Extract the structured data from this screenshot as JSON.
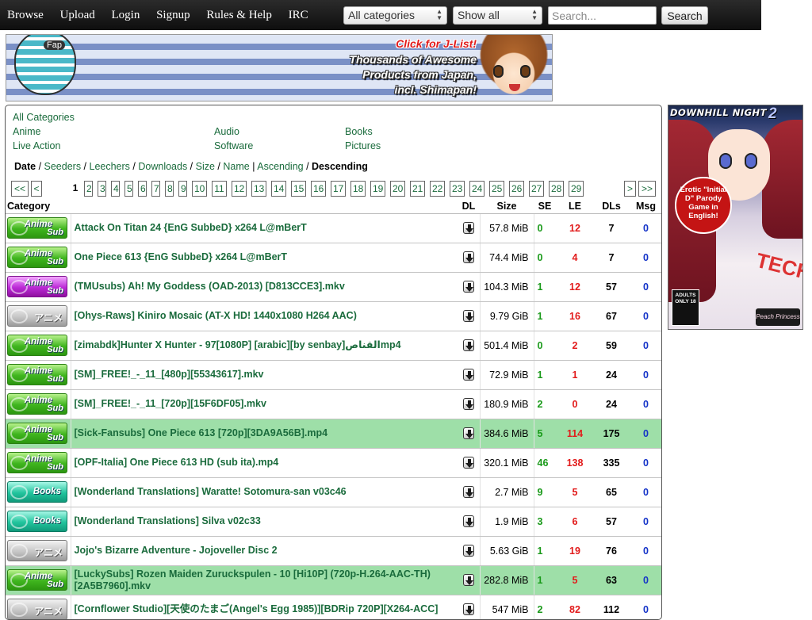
{
  "nav": {
    "items": [
      {
        "label": "Browse"
      },
      {
        "label": "Upload"
      },
      {
        "label": "Login"
      },
      {
        "label": "Signup"
      },
      {
        "label": "Rules & Help"
      },
      {
        "label": "IRC"
      }
    ]
  },
  "search": {
    "category_value": "All categories",
    "filter_value": "Show all",
    "placeholder": "Search...",
    "button_label": "Search"
  },
  "banner_top": {
    "headline": "Click for J-List!",
    "line1": "Thousands of Awesome",
    "line2": "Products from Japan,",
    "line3": "incl. Shimapan!",
    "hat_text": "Fap"
  },
  "categories": {
    "all": "All Categories",
    "anime": "Anime",
    "audio": "Audio",
    "books": "Books",
    "live_action": "Live Action",
    "software": "Software",
    "pictures": "Pictures"
  },
  "sort": {
    "date": "Date",
    "seeders": "Seeders",
    "leechers": "Leechers",
    "downloads": "Downloads",
    "size": "Size",
    "name": "Name",
    "ascending": "Ascending",
    "descending": "Descending"
  },
  "pager": {
    "first": "<<",
    "prev": "<",
    "next": ">",
    "last": ">>",
    "current": "1",
    "pages": [
      "2",
      "3",
      "4",
      "5",
      "6",
      "7",
      "8",
      "9",
      "10",
      "11",
      "12",
      "13",
      "14",
      "15",
      "16",
      "17",
      "18",
      "19",
      "20",
      "21",
      "22",
      "23",
      "24",
      "25",
      "26",
      "27",
      "28",
      "29"
    ]
  },
  "table": {
    "headers": {
      "category": "Category",
      "dl": "DL",
      "size": "Size",
      "se": "SE",
      "le": "LE",
      "dls": "DLs",
      "msg": "Msg"
    },
    "rows": [
      {
        "badge": "anime",
        "badge_l1": "Anime",
        "badge_l2": "Sub",
        "name": "Attack On Titan 24 {EnG SubbeD} x264 L@mBerT",
        "size": "57.8 MiB",
        "se": "0",
        "le": "12",
        "dls": "7",
        "msg": "0",
        "highlight": false
      },
      {
        "badge": "anime",
        "badge_l1": "Anime",
        "badge_l2": "Sub",
        "name": "One Piece 613 {EnG SubbeD} x264 L@mBerT",
        "size": "74.4 MiB",
        "se": "0",
        "le": "4",
        "dls": "7",
        "msg": "0",
        "highlight": false
      },
      {
        "badge": "animesub-p",
        "badge_l1": "Anime",
        "badge_l2": "Sub",
        "name": "(TMUsubs) Ah! My Goddess (OAD-2013) [D813CCE3].mkv",
        "size": "104.3 MiB",
        "se": "1",
        "le": "12",
        "dls": "57",
        "msg": "0",
        "highlight": false
      },
      {
        "badge": "raw",
        "badge_l1": "アニメ",
        "badge_l2": "",
        "name": "[Ohys-Raws] Kiniro Mosaic (AT-X HD! 1440x1080 H264 AAC)",
        "size": "9.79 GiB",
        "se": "1",
        "le": "16",
        "dls": "67",
        "msg": "0",
        "highlight": false
      },
      {
        "badge": "anime",
        "badge_l1": "Anime",
        "badge_l2": "Sub",
        "name": "[zimabdk]Hunter X Hunter - 97[1080P] [arabic][by senbay]القناصmp4",
        "size": "501.4 MiB",
        "se": "0",
        "le": "2",
        "dls": "59",
        "msg": "0",
        "highlight": false
      },
      {
        "badge": "anime",
        "badge_l1": "Anime",
        "badge_l2": "Sub",
        "name": "[SM]_FREE!_-_11_[480p][55343617].mkv",
        "size": "72.9 MiB",
        "se": "1",
        "le": "1",
        "dls": "24",
        "msg": "0",
        "highlight": false
      },
      {
        "badge": "anime",
        "badge_l1": "Anime",
        "badge_l2": "Sub",
        "name": "[SM]_FREE!_-_11_[720p][15F6DF05].mkv",
        "size": "180.9 MiB",
        "se": "2",
        "le": "0",
        "dls": "24",
        "msg": "0",
        "highlight": false
      },
      {
        "badge": "anime",
        "badge_l1": "Anime",
        "badge_l2": "Sub",
        "name": "[Sick-Fansubs] One Piece 613 [720p][3DA9A56B].mp4",
        "size": "384.6 MiB",
        "se": "5",
        "le": "114",
        "dls": "175",
        "msg": "0",
        "highlight": true
      },
      {
        "badge": "anime",
        "badge_l1": "Anime",
        "badge_l2": "Sub",
        "name": "[OPF-Italia] One Piece 613 HD (sub ita).mp4",
        "size": "320.1 MiB",
        "se": "46",
        "le": "138",
        "dls": "335",
        "msg": "0",
        "highlight": false
      },
      {
        "badge": "books",
        "badge_l1": "Books",
        "badge_l2": "",
        "name": "[Wonderland Translations] Waratte! Sotomura-san v03c46",
        "size": "2.7 MiB",
        "se": "9",
        "le": "5",
        "dls": "65",
        "msg": "0",
        "highlight": false
      },
      {
        "badge": "books",
        "badge_l1": "Books",
        "badge_l2": "",
        "name": "[Wonderland Translations] Silva v02c33",
        "size": "1.9 MiB",
        "se": "3",
        "le": "6",
        "dls": "57",
        "msg": "0",
        "highlight": false
      },
      {
        "badge": "raw",
        "badge_l1": "アニメ",
        "badge_l2": "",
        "name": "Jojo's Bizarre Adventure - Jojoveller Disc 2",
        "size": "5.63 GiB",
        "se": "1",
        "le": "19",
        "dls": "76",
        "msg": "0",
        "highlight": false
      },
      {
        "badge": "anime",
        "badge_l1": "Anime",
        "badge_l2": "Sub",
        "name": "[LuckySubs] Rozen Maiden Zuruckspulen - 10 [Hi10P] (720p-H.264-AAC-TH) [2A5B7960].mkv",
        "size": "282.8 MiB",
        "se": "1",
        "le": "5",
        "dls": "63",
        "msg": "0",
        "highlight": true
      },
      {
        "badge": "raw",
        "badge_l1": "アニメ",
        "badge_l2": "",
        "name": "[Cornflower Studio][天使のたまご(Angel's Egg 1985)][BDRip 720P][X264-ACC]",
        "size": "547 MiB",
        "se": "2",
        "le": "82",
        "dls": "112",
        "msg": "0",
        "highlight": false
      }
    ]
  },
  "banner_side": {
    "title": "DOWNHILL NIGHT",
    "title_num": "2",
    "bubble": "Erotic \"Initial D\" Parody Game in English!",
    "adults": "ADULTS ONLY 18",
    "publisher": "Peach Princess"
  },
  "colors": {
    "topbar": "#1c1c1c",
    "link": "#1a6b3c",
    "seeders": "#1a9a1a",
    "leechers": "#e21b1b",
    "msg": "#1433c8",
    "highlight_row": "#9edfa8"
  }
}
